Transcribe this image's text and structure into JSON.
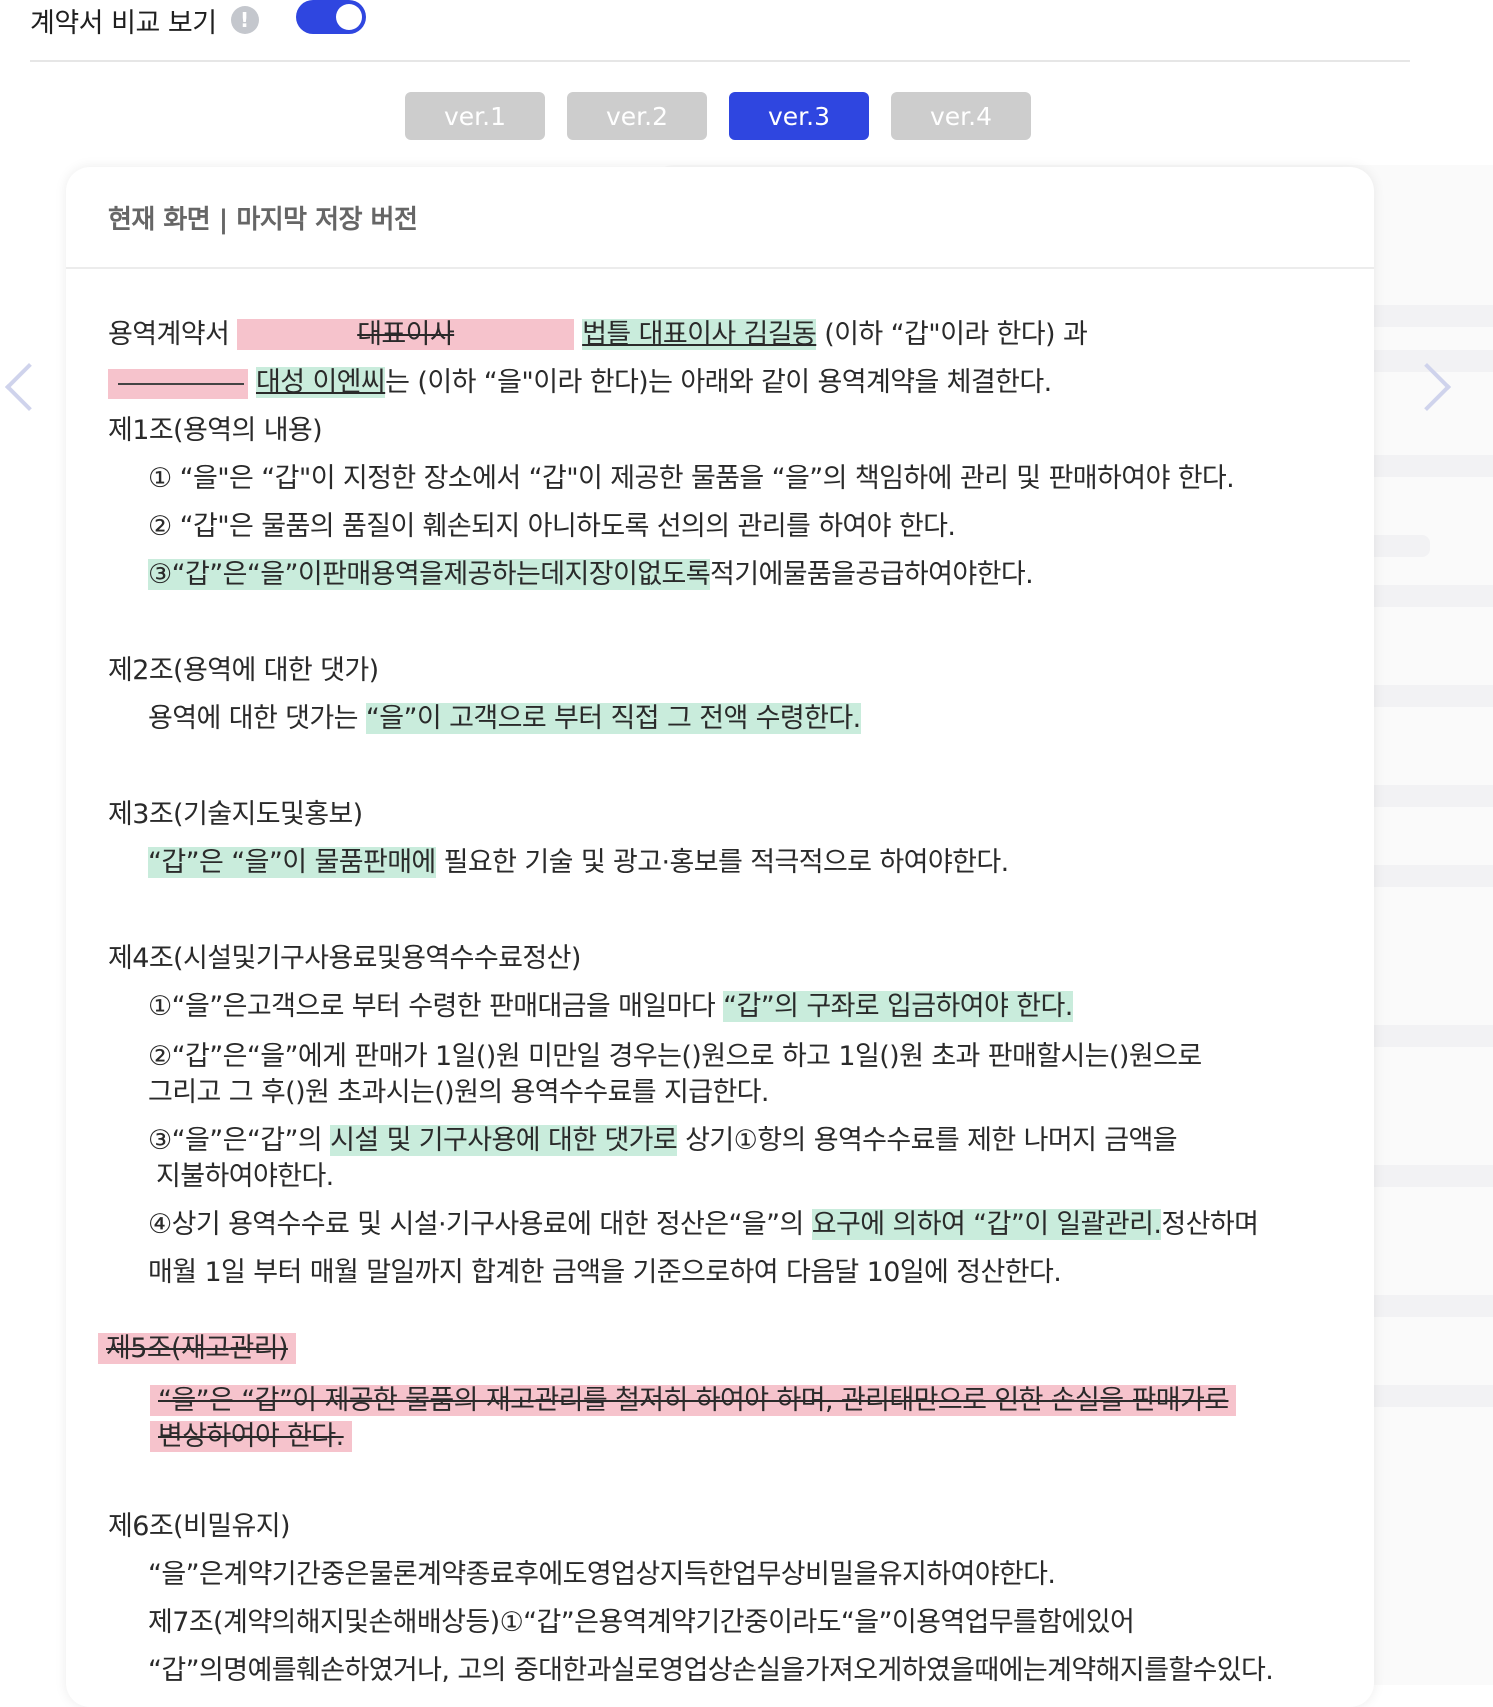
{
  "header": {
    "title": "계약서 비교 보기",
    "info_icon": "!"
  },
  "versions": [
    {
      "label": "ver.1",
      "active": false
    },
    {
      "label": "ver.2",
      "active": false
    },
    {
      "label": "ver.3",
      "active": true
    },
    {
      "label": "ver.4",
      "active": false
    }
  ],
  "card": {
    "title": "현재 화면 | 마지막 저장 버전"
  },
  "doc": {
    "l1_a": "용역계약서 ",
    "l1_del": "대표이사",
    "l1_add": "법틀 대표이사 김길동",
    "l1_b": " (이하 “갑\"이라 한다) 과",
    "l2_add": "대성 이엔씨",
    "l2_b": "는 (이하 “을\"이라 한다)는 아래와 같이 용역계약을 체결한다.",
    "a1_title": "제1조(용역의 내용)",
    "a1_1": "① “을\"은 “갑\"이 지정한 장소에서 “갑\"이 제공한 물품을 “을”의 책임하에 관리 및 판매하여야 한다.",
    "a1_2": "② “갑\"은 물품의 품질이 훼손되지 아니하도록 선의의 관리를 하여야 한다.",
    "a1_3_add": "③“갑”은“을”이판매용역을제공하는데지장이없도록",
    "a1_3_b": "적기에물품을공급하여야한다.",
    "a2_title": "제2조(용역에 대한 댓가)",
    "a2_a": "용역에 대한 댓가는 ",
    "a2_add": "“을”이 고객으로 부터 직접 그 전액 수령한다.",
    "a3_title": "제3조(기술지도및홍보)",
    "a3_add": "“갑”은 “을”이 물품판매에",
    "a3_b": " 필요한 기술 및 광고·홍보를 적극적으로 하여야한다.",
    "a4_title": "제4조(시설및기구사용료및용역수수료정산)",
    "a4_1a": "①“을”은고객으로 부터 수령한 판매대금을 매일마다 ",
    "a4_1add": "“갑”의 구좌로 입금하여야 한다.",
    "a4_2a": "②“갑”은“을”에게 판매가 1일()원 미만일 경우는()원으로 하고 1일()원 초과 판매할시는()원으로",
    "a4_2b": "그리고 그 후()원 초과시는()원의 용역수수료를 지급한다.",
    "a4_3a": "③“을”은“갑”의 ",
    "a4_3add": "시설 및 기구사용에 대한 댓가로",
    "a4_3b": " 상기①항의 용역수수료를 제한 나머지 금액을",
    "a4_3c": "지불하여야한다.",
    "a4_4a": "④상기 용역수수료 및 시설·기구사용료에 대한 정산은“을”의 ",
    "a4_4add": "요구에 의하여 “갑”이 일괄관리.",
    "a4_4b": "정산하며",
    "a4_4c": "매월 1일 부터 매월 말일까지 합계한 금액을 기준으로하여 다음달 10일에 정산한다.",
    "a5_title": "제5조(재고관리)",
    "a5_a": "“을”은 “갑”이 제공한 물품의 재고관리를 철저히 하여야 하며, 관리태만으로 인한 손실을 판매가로",
    "a5_b": "변상하여야 한다.",
    "a6_title": "제6조(비밀유지)",
    "a6_a": "“을”은계약기간중은물론계약종료후에도영업상지득한업무상비밀을유지하여야한다.",
    "a7_a": "제7조(계약의해지및손해배상등)①“갑”은용역계약기간중이라도“을”이용역업무를함에있어",
    "a7_b": "“갑”의명예를훼손하였거나, 고의 중대한과실로영업상손실을가져오게하였을때에는계약해지를할수있다."
  },
  "colors": {
    "accent": "#2f46e0",
    "added": "#c9ecdc",
    "deleted": "#f6c3cc",
    "inactive_tab": "#cdcdcd"
  },
  "icons": {
    "prev": "chevron-left-icon",
    "next": "chevron-right-icon"
  }
}
